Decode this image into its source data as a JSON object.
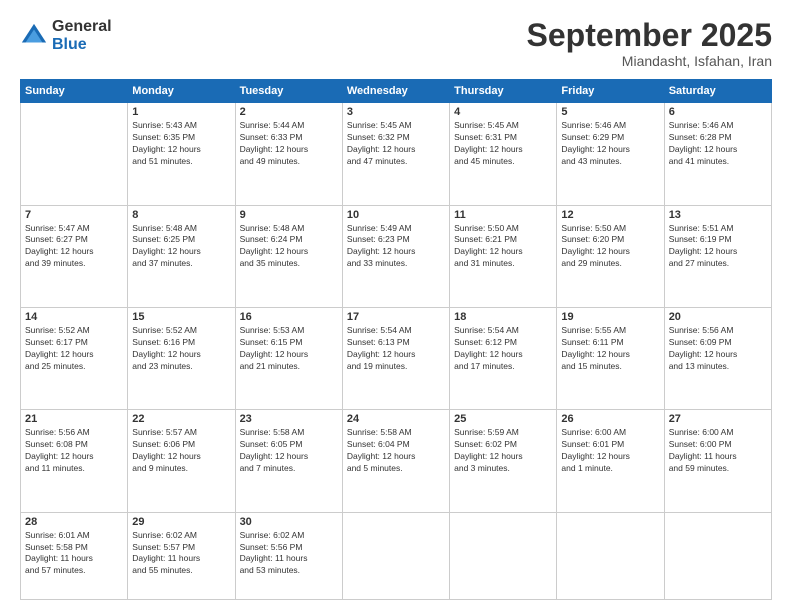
{
  "logo": {
    "general": "General",
    "blue": "Blue"
  },
  "header": {
    "month": "September 2025",
    "location": "Miandasht, Isfahan, Iran"
  },
  "weekdays": [
    "Sunday",
    "Monday",
    "Tuesday",
    "Wednesday",
    "Thursday",
    "Friday",
    "Saturday"
  ],
  "weeks": [
    [
      {
        "day": "",
        "info": ""
      },
      {
        "day": "1",
        "info": "Sunrise: 5:43 AM\nSunset: 6:35 PM\nDaylight: 12 hours\nand 51 minutes."
      },
      {
        "day": "2",
        "info": "Sunrise: 5:44 AM\nSunset: 6:33 PM\nDaylight: 12 hours\nand 49 minutes."
      },
      {
        "day": "3",
        "info": "Sunrise: 5:45 AM\nSunset: 6:32 PM\nDaylight: 12 hours\nand 47 minutes."
      },
      {
        "day": "4",
        "info": "Sunrise: 5:45 AM\nSunset: 6:31 PM\nDaylight: 12 hours\nand 45 minutes."
      },
      {
        "day": "5",
        "info": "Sunrise: 5:46 AM\nSunset: 6:29 PM\nDaylight: 12 hours\nand 43 minutes."
      },
      {
        "day": "6",
        "info": "Sunrise: 5:46 AM\nSunset: 6:28 PM\nDaylight: 12 hours\nand 41 minutes."
      }
    ],
    [
      {
        "day": "7",
        "info": "Sunrise: 5:47 AM\nSunset: 6:27 PM\nDaylight: 12 hours\nand 39 minutes."
      },
      {
        "day": "8",
        "info": "Sunrise: 5:48 AM\nSunset: 6:25 PM\nDaylight: 12 hours\nand 37 minutes."
      },
      {
        "day": "9",
        "info": "Sunrise: 5:48 AM\nSunset: 6:24 PM\nDaylight: 12 hours\nand 35 minutes."
      },
      {
        "day": "10",
        "info": "Sunrise: 5:49 AM\nSunset: 6:23 PM\nDaylight: 12 hours\nand 33 minutes."
      },
      {
        "day": "11",
        "info": "Sunrise: 5:50 AM\nSunset: 6:21 PM\nDaylight: 12 hours\nand 31 minutes."
      },
      {
        "day": "12",
        "info": "Sunrise: 5:50 AM\nSunset: 6:20 PM\nDaylight: 12 hours\nand 29 minutes."
      },
      {
        "day": "13",
        "info": "Sunrise: 5:51 AM\nSunset: 6:19 PM\nDaylight: 12 hours\nand 27 minutes."
      }
    ],
    [
      {
        "day": "14",
        "info": "Sunrise: 5:52 AM\nSunset: 6:17 PM\nDaylight: 12 hours\nand 25 minutes."
      },
      {
        "day": "15",
        "info": "Sunrise: 5:52 AM\nSunset: 6:16 PM\nDaylight: 12 hours\nand 23 minutes."
      },
      {
        "day": "16",
        "info": "Sunrise: 5:53 AM\nSunset: 6:15 PM\nDaylight: 12 hours\nand 21 minutes."
      },
      {
        "day": "17",
        "info": "Sunrise: 5:54 AM\nSunset: 6:13 PM\nDaylight: 12 hours\nand 19 minutes."
      },
      {
        "day": "18",
        "info": "Sunrise: 5:54 AM\nSunset: 6:12 PM\nDaylight: 12 hours\nand 17 minutes."
      },
      {
        "day": "19",
        "info": "Sunrise: 5:55 AM\nSunset: 6:11 PM\nDaylight: 12 hours\nand 15 minutes."
      },
      {
        "day": "20",
        "info": "Sunrise: 5:56 AM\nSunset: 6:09 PM\nDaylight: 12 hours\nand 13 minutes."
      }
    ],
    [
      {
        "day": "21",
        "info": "Sunrise: 5:56 AM\nSunset: 6:08 PM\nDaylight: 12 hours\nand 11 minutes."
      },
      {
        "day": "22",
        "info": "Sunrise: 5:57 AM\nSunset: 6:06 PM\nDaylight: 12 hours\nand 9 minutes."
      },
      {
        "day": "23",
        "info": "Sunrise: 5:58 AM\nSunset: 6:05 PM\nDaylight: 12 hours\nand 7 minutes."
      },
      {
        "day": "24",
        "info": "Sunrise: 5:58 AM\nSunset: 6:04 PM\nDaylight: 12 hours\nand 5 minutes."
      },
      {
        "day": "25",
        "info": "Sunrise: 5:59 AM\nSunset: 6:02 PM\nDaylight: 12 hours\nand 3 minutes."
      },
      {
        "day": "26",
        "info": "Sunrise: 6:00 AM\nSunset: 6:01 PM\nDaylight: 12 hours\nand 1 minute."
      },
      {
        "day": "27",
        "info": "Sunrise: 6:00 AM\nSunset: 6:00 PM\nDaylight: 11 hours\nand 59 minutes."
      }
    ],
    [
      {
        "day": "28",
        "info": "Sunrise: 6:01 AM\nSunset: 5:58 PM\nDaylight: 11 hours\nand 57 minutes."
      },
      {
        "day": "29",
        "info": "Sunrise: 6:02 AM\nSunset: 5:57 PM\nDaylight: 11 hours\nand 55 minutes."
      },
      {
        "day": "30",
        "info": "Sunrise: 6:02 AM\nSunset: 5:56 PM\nDaylight: 11 hours\nand 53 minutes."
      },
      {
        "day": "",
        "info": ""
      },
      {
        "day": "",
        "info": ""
      },
      {
        "day": "",
        "info": ""
      },
      {
        "day": "",
        "info": ""
      }
    ]
  ]
}
